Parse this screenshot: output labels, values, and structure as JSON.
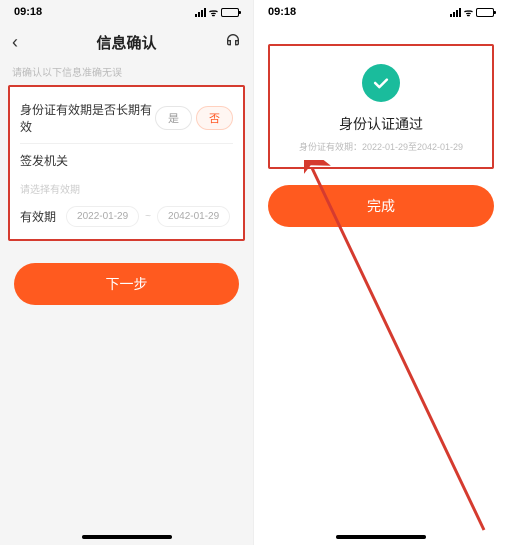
{
  "status": {
    "time": "09:18"
  },
  "left": {
    "nav_title": "信息确认",
    "hint": "请确认以下信息准确无误",
    "long_term_label": "身份证有效期是否长期有效",
    "opt_yes": "是",
    "opt_no": "否",
    "issuer_label": "签发机关",
    "select_period_hint": "请选择有效期",
    "period_label": "有效期",
    "date_start": "2022-01-29",
    "date_end": "2042-01-29",
    "tilde": "~",
    "next_btn": "下一步"
  },
  "right": {
    "result_title": "身份认证通过",
    "result_sub": "身份证有效期：2022-01-29至2042-01-29",
    "done_btn": "完成"
  }
}
